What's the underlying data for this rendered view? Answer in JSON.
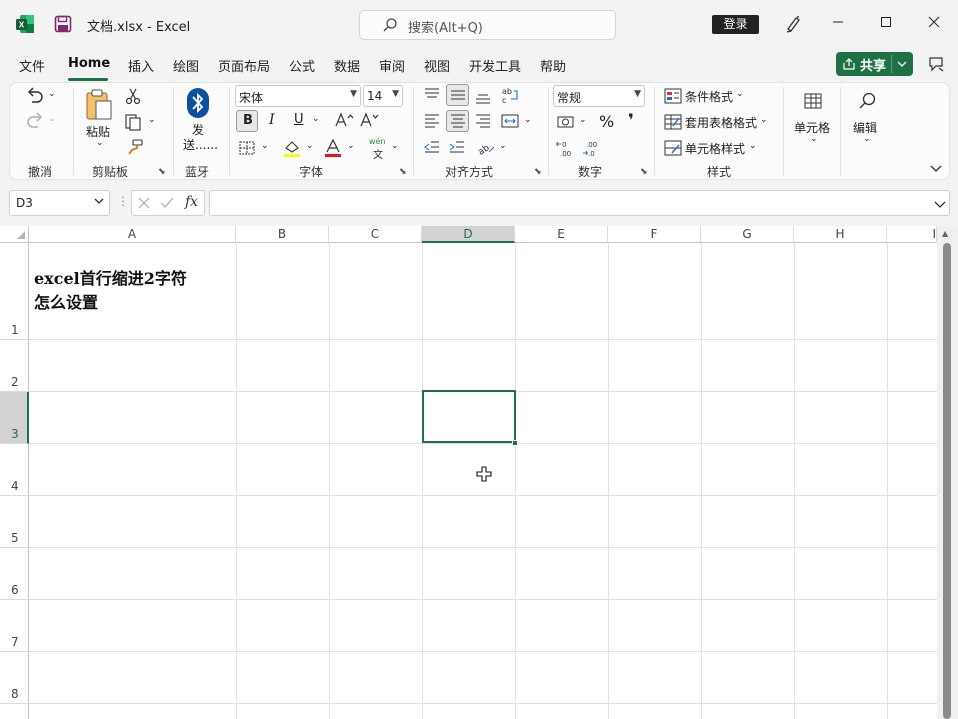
{
  "titlebar": {
    "app_icon": "excel-logo-icon",
    "save_icon": "save-icon",
    "title": "文档.xlsx  -  Excel",
    "search_placeholder": "搜索(Alt+Q)",
    "login_label": "登录",
    "pen_icon": "pen-icon"
  },
  "menu": {
    "items": [
      "文件",
      "Home",
      "插入",
      "绘图",
      "页面布局",
      "公式",
      "数据",
      "审阅",
      "视图",
      "开发工具",
      "帮助"
    ],
    "active": "Home",
    "share_label": "共享"
  },
  "ribbon": {
    "groups": {
      "undo": "撤消",
      "clipboard": "剪贴板",
      "bluetooth": "蓝牙",
      "font": "字体",
      "alignment": "对齐方式",
      "number": "数字",
      "styles": "样式"
    },
    "paste_label": "粘贴",
    "send_label_1": "发",
    "send_label_2": "送......",
    "font_name": "宋体",
    "font_size": "14",
    "bold": "B",
    "italic": "I",
    "underline": "U",
    "number_format": "常规",
    "conditional_format": "条件格式",
    "table_format": "套用表格格式",
    "cell_style": "单元格样式",
    "cells_label": "单元格",
    "edit_label": "编辑",
    "percent": "%",
    "comma": "❜",
    "wen": "wén",
    "wen_char": "文"
  },
  "formula_bar": {
    "name_box": "D3",
    "fx": "fx",
    "content": ""
  },
  "sheet": {
    "columns": [
      "A",
      "B",
      "C",
      "D",
      "E",
      "F",
      "G",
      "H",
      "I"
    ],
    "rows": [
      "1",
      "2",
      "3",
      "4",
      "5",
      "6",
      "7",
      "8"
    ],
    "selected_cell": "D3",
    "a1_line1": "excel首行缩进2字符",
    "a1_line2": "怎么设置"
  },
  "colors": {
    "accent": "#1e7145",
    "font_color_underline": "#e81123",
    "highlight_underline": "#ffff00"
  }
}
